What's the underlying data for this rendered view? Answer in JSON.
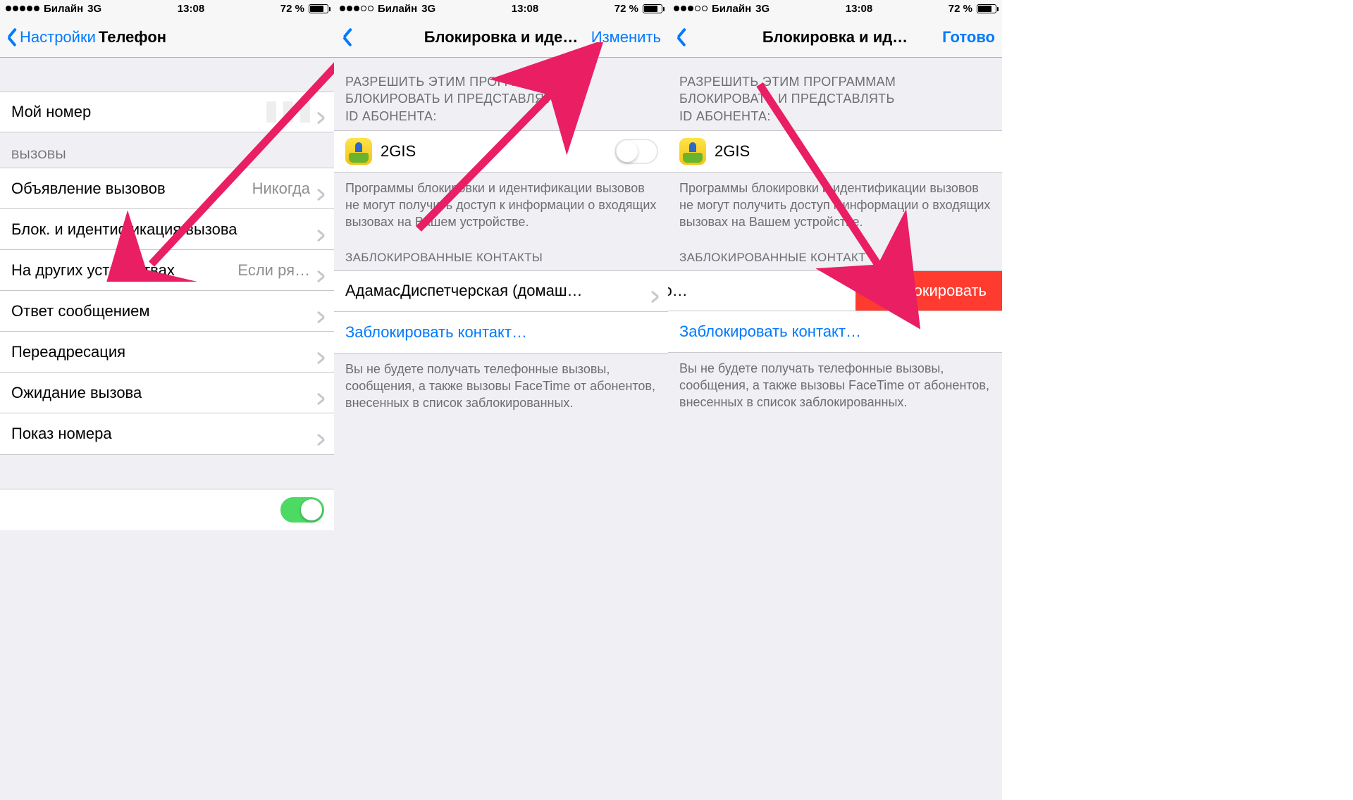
{
  "status": {
    "carrier": "Билайн",
    "net": "3G",
    "time": "13:08",
    "battery_pct": "72 %",
    "signal_filled_a": 5,
    "signal_filled_b": 3,
    "signal_filled_c": 3
  },
  "pane1": {
    "back_label": "Настройки",
    "title": "Телефон",
    "my_number_label": "Мой номер",
    "calls_header": "ВЫЗОВЫ",
    "items": {
      "announce": {
        "label": "Объявление вызовов",
        "value": "Никогда"
      },
      "blockid": {
        "label": "Блок. и идентификация вызова"
      },
      "otherdev": {
        "label": "На других устройствах",
        "value": "Если ря…"
      },
      "smsreply": {
        "label": "Ответ сообщением"
      },
      "forward": {
        "label": "Переадресация"
      },
      "waiting": {
        "label": "Ожидание вызова"
      },
      "callerid": {
        "label": "Показ номера"
      }
    }
  },
  "shared": {
    "allow_header_l1": "РАЗРЕШИТЬ ЭТИМ ПРОГРАММАМ",
    "allow_header_l2": "БЛОКИРОВАТЬ И ПРЕДСТАВЛЯТЬ",
    "allow_header_l3": "ID АБОНЕНТА:",
    "app_name": "2GIS",
    "allow_footer": "Программы блокировки и идентификации вызовов не могут получить доступ к информации о входящих вызовах на Вашем устройстве.",
    "blocked_header": "ЗАБЛОКИРОВАННЫЕ КОНТАКТЫ",
    "block_contact": "Заблокировать контакт…",
    "blocked_footer": "Вы не будете получать телефонные вызовы, сообщения, а также вызовы FaceTime от абонентов, внесенных в список заблокированных."
  },
  "pane2": {
    "title": "Блокировка и иде…",
    "edit": "Изменить",
    "contact": "АдамасДиспетчерская (домаш…"
  },
  "pane3": {
    "title": "Блокировка и ид…",
    "done": "Готово",
    "contact_swiped": "тчерская (до…",
    "unblock": "Разблокировать",
    "blocked_header_trunc": "ЗАБЛОКИРОВАННЫЕ КОНТАКТ"
  }
}
